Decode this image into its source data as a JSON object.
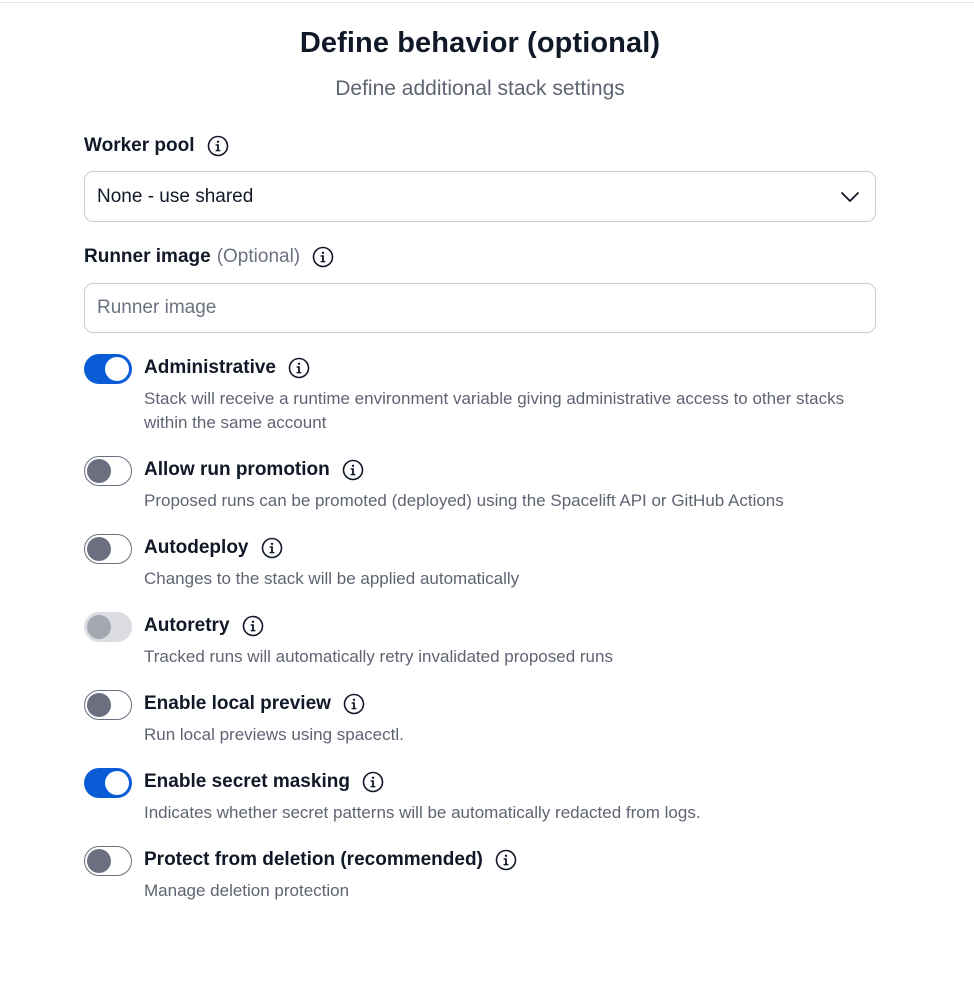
{
  "header": {
    "title": "Define behavior (optional)",
    "subtitle": "Define additional stack settings"
  },
  "worker_pool": {
    "label": "Worker pool",
    "value": "None - use shared"
  },
  "runner_image": {
    "label": "Runner image",
    "optional": "(Optional)",
    "placeholder": "Runner image",
    "value": ""
  },
  "options": [
    {
      "title": "Administrative",
      "description": "Stack will receive a runtime environment variable giving administrative access to other stacks within the same account",
      "state": "on"
    },
    {
      "title": "Allow run promotion",
      "description": "Proposed runs can be promoted (deployed) using the Spacelift API or GitHub Actions",
      "state": "off"
    },
    {
      "title": "Autodeploy",
      "description": "Changes to the stack will be applied automatically",
      "state": "off"
    },
    {
      "title": "Autoretry",
      "description": "Tracked runs will automatically retry invalidated proposed runs",
      "state": "disabled"
    },
    {
      "title": "Enable local preview",
      "description": "Run local previews using spacectl.",
      "state": "off"
    },
    {
      "title": "Enable secret masking",
      "description": "Indicates whether secret patterns will be automatically redacted from logs.",
      "state": "on"
    },
    {
      "title": "Protect from deletion (recommended)",
      "description": "Manage deletion protection",
      "state": "off"
    }
  ],
  "icons": {
    "info": "info-icon",
    "chevron": "chevron-down-icon"
  },
  "colors": {
    "toggle_on": "#0a5bd6",
    "toggle_off_knob": "#6b6f80",
    "toggle_disabled": "#dcdde2"
  }
}
